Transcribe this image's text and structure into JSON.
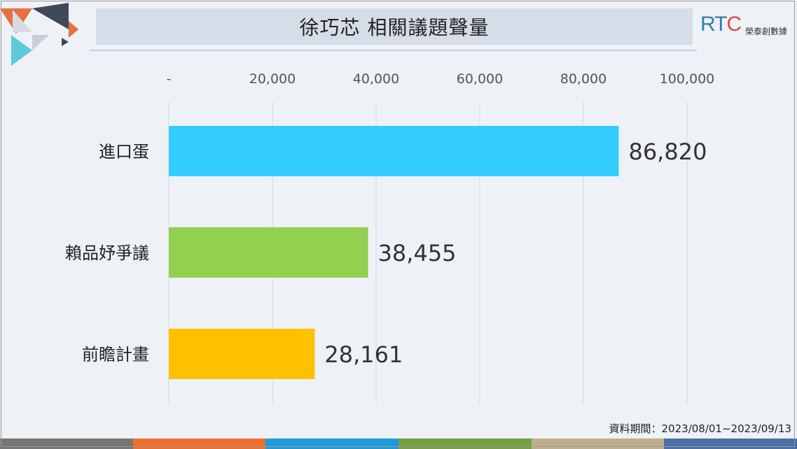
{
  "header": {
    "title": "徐巧芯 相關議題聲量",
    "logo_text_r": "RT",
    "logo_text_c": "C",
    "logo_subtitle": "榮泰創數據"
  },
  "footer": {
    "period_note": "資料期間：2023/08/01~2023/09/13"
  },
  "colors": {
    "background": "#eef1f6",
    "title_bar": "#d5dde8",
    "stripe": [
      "#767676",
      "#ed7030",
      "#1e9bd7",
      "#75a143",
      "#bfae8c",
      "#4a6fa5"
    ]
  },
  "chart_data": {
    "type": "bar",
    "orientation": "horizontal",
    "title": "徐巧芯 相關議題聲量",
    "categories": [
      "進口蛋",
      "賴品妤爭議",
      "前瞻計畫"
    ],
    "values": [
      86820,
      38455,
      28161
    ],
    "value_labels": [
      "86,820",
      "38,455",
      "28,161"
    ],
    "bar_colors": [
      "#33ccff",
      "#92d050",
      "#ffc000"
    ],
    "xlim": [
      0,
      100000
    ],
    "xticks": [
      0,
      20000,
      40000,
      60000,
      80000,
      100000
    ],
    "xtick_labels": [
      "-",
      "20,000",
      "40,000",
      "60,000",
      "80,000",
      "100,000"
    ],
    "xaxis_position": "top",
    "grid": true,
    "legend": "none"
  }
}
